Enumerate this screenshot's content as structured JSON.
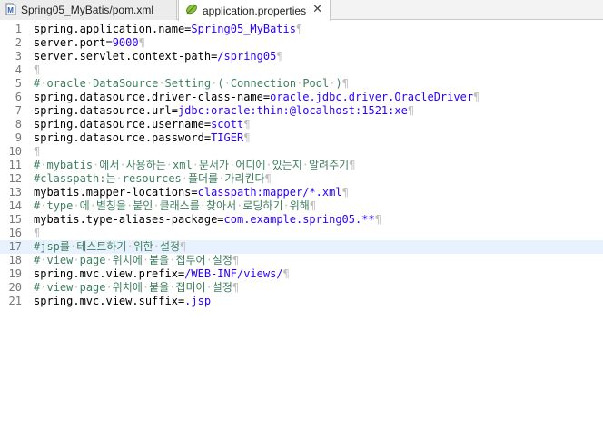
{
  "tabs": [
    {
      "label": "Spring05_MyBatis/pom.xml",
      "icon": "maven-file-icon",
      "active": false
    },
    {
      "label": "application.properties",
      "icon": "properties-file-icon",
      "active": true,
      "close": "✕"
    }
  ],
  "colors": {
    "key": "#000000",
    "value": "#2a00ff",
    "comment": "#3f7f5f",
    "whitespace_marker": "#c0c0c0",
    "line_number": "#787878",
    "current_line": "#e8f2fe"
  },
  "editor": {
    "current_line": 17,
    "lines": [
      {
        "n": "1",
        "kind": "pair",
        "key": "spring.application.name=",
        "value": "Spring05_MyBatis"
      },
      {
        "n": "2",
        "kind": "pair",
        "key": "server.port=",
        "value": "9000"
      },
      {
        "n": "3",
        "kind": "pair",
        "key": "server.servlet.context-path=",
        "value": "/spring05"
      },
      {
        "n": "4",
        "kind": "empty"
      },
      {
        "n": "5",
        "kind": "comment",
        "text": "# oracle DataSource Setting ( Connection Pool )"
      },
      {
        "n": "6",
        "kind": "pair",
        "key": "spring.datasource.driver-class-name=",
        "value": "oracle.jdbc.driver.OracleDriver"
      },
      {
        "n": "7",
        "kind": "pair",
        "key": "spring.datasource.url=",
        "value": "jdbc:oracle:thin:@localhost:1521:xe"
      },
      {
        "n": "8",
        "kind": "pair",
        "key": "spring.datasource.username=",
        "value": "scott"
      },
      {
        "n": "9",
        "kind": "pair",
        "key": "spring.datasource.password=",
        "value": "TIGER"
      },
      {
        "n": "10",
        "kind": "empty"
      },
      {
        "n": "11",
        "kind": "comment",
        "text": "# mybatis 에서 사용하는 xml 문서가 어디에 있는지 알려주기"
      },
      {
        "n": "12",
        "kind": "comment",
        "text": "#classpath:는 resources 폴더를 가리킨다"
      },
      {
        "n": "13",
        "kind": "pair",
        "key": "mybatis.mapper-locations=",
        "value": "classpath:mapper/*.xml"
      },
      {
        "n": "14",
        "kind": "comment",
        "text": "# type 에 별칭을 붙인 클래스를 찾아서 로딩하기 위해"
      },
      {
        "n": "15",
        "kind": "pair",
        "key": "mybatis.type-aliases-package=",
        "value": "com.example.spring05.**"
      },
      {
        "n": "16",
        "kind": "empty"
      },
      {
        "n": "17",
        "kind": "comment",
        "text": "#jsp를 테스트하기 위한 설정"
      },
      {
        "n": "18",
        "kind": "comment",
        "text": "# view page 위치에 붙을 접두어 설정"
      },
      {
        "n": "19",
        "kind": "pair",
        "key": "spring.mvc.view.prefix=",
        "value": "/WEB-INF/views/"
      },
      {
        "n": "20",
        "kind": "comment",
        "text": "# view page 위치에 붙을 접미어 설정"
      },
      {
        "n": "21",
        "kind": "pair",
        "key": "spring.mvc.view.suffix=",
        "value": ".jsp",
        "no_eol_marker": true
      }
    ],
    "eol_marker": "¶",
    "space_marker": "·"
  }
}
